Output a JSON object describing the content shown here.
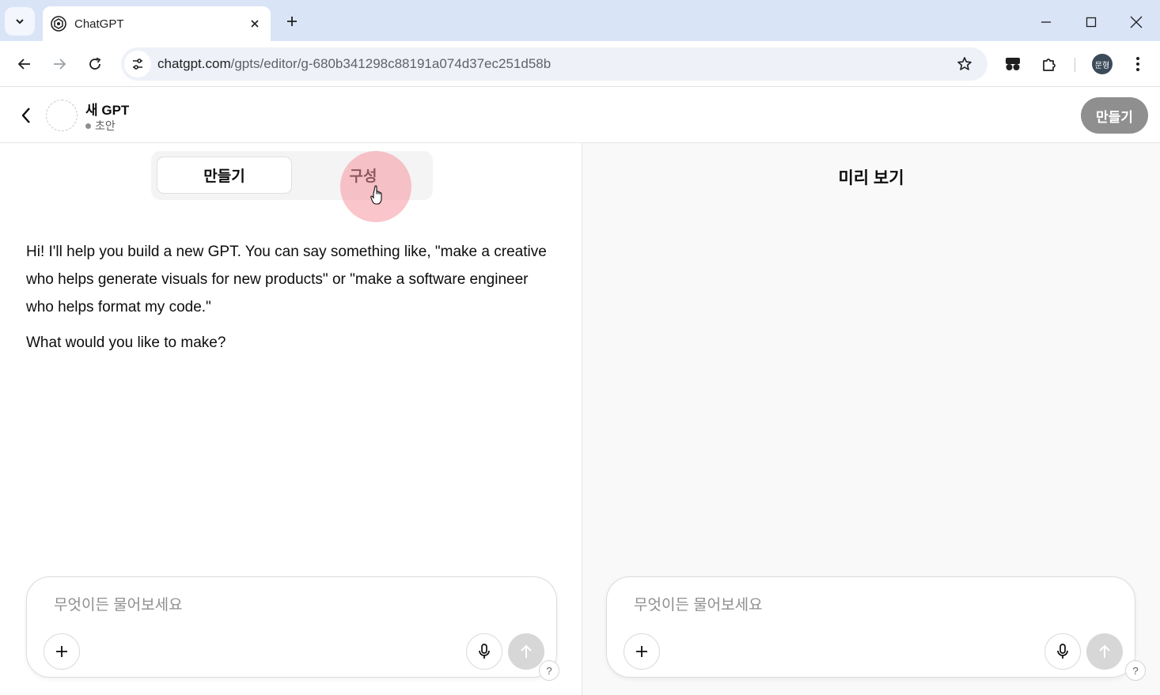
{
  "browser": {
    "tab_title": "ChatGPT",
    "url_host": "chatgpt.com",
    "url_path": "/gpts/editor/g-680b341298c88191a074d37ec251d58b",
    "profile_initials": "문형"
  },
  "header": {
    "gpt_name": "새 GPT",
    "status": "초안",
    "create_button": "만들기"
  },
  "tabs": {
    "create": "만들기",
    "configure": "구성",
    "selected": "create"
  },
  "conversation": {
    "messages": [
      "Hi! I'll help you build a new GPT. You can say something like, \"make a creative who helps generate visuals for new products\" or \"make a software engineer who helps format my code.\"",
      "What would you like to make?"
    ]
  },
  "preview": {
    "title": "미리 보기"
  },
  "composer": {
    "placeholder": "무엇이든 물어보세요"
  },
  "help_label": "?",
  "icons": {
    "tab_list": "chevron-down-icon",
    "favicon": "openai-logo-icon",
    "close": "close-icon",
    "new_tab": "plus-icon",
    "back": "arrow-left-icon",
    "forward": "arrow-right-icon",
    "reload": "reload-icon",
    "site_info": "tune-icon",
    "bookmark": "star-icon",
    "extension": "puzzle-icon",
    "menu": "more-vertical-icon",
    "mic": "microphone-icon",
    "send": "arrow-up-icon"
  }
}
